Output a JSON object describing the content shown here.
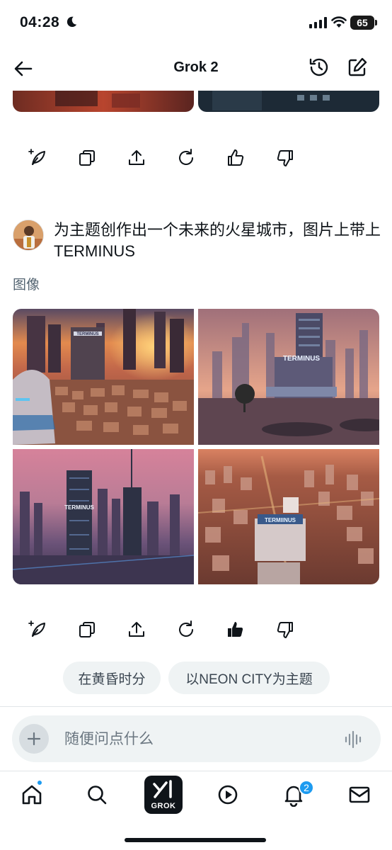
{
  "status_bar": {
    "time": "04:28",
    "battery": "65"
  },
  "header": {
    "title": "Grok 2",
    "back_icon": "arrow-left-icon",
    "history_icon": "history-icon",
    "edit_icon": "compose-icon"
  },
  "message_actions": [
    "regenerate-style-icon",
    "copy-icon",
    "share-icon",
    "refresh-icon",
    "thumbs-up-icon",
    "thumbs-down-icon"
  ],
  "user_message": {
    "text": "为主题创作出一个未来的火星城市，图片上带上TERMINUS"
  },
  "response": {
    "label": "图像",
    "images": [
      {
        "sign": "TERMINUS"
      },
      {
        "sign": "TERMINUS"
      },
      {
        "sign": "TERMINUS"
      },
      {
        "sign": "TERMIINUS"
      }
    ]
  },
  "suggestions": [
    "在黄昏时分",
    "以NEON CITY为主题"
  ],
  "composer": {
    "placeholder": "随便问点什么"
  },
  "bottom_nav": {
    "grok_label": "GROK",
    "notifications_count": "2"
  },
  "colors": {
    "accent": "#1d9bf0",
    "chip_bg": "#eff3f4",
    "text": "#0f1419",
    "muted": "#536471"
  }
}
